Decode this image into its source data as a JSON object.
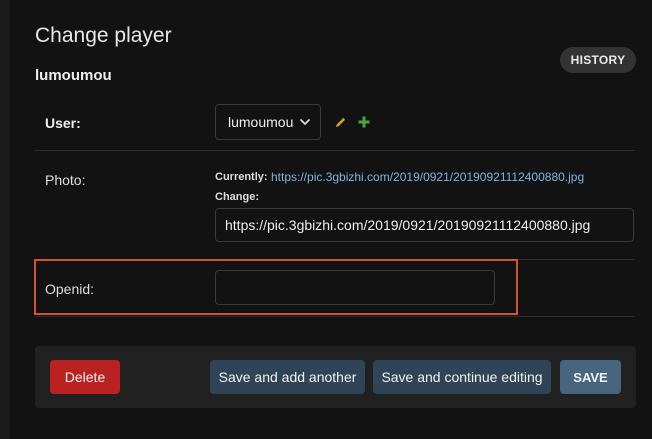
{
  "page": {
    "title": "Change player",
    "object_name": "lumoumou"
  },
  "header": {
    "history_label": "HISTORY"
  },
  "fields": {
    "user": {
      "label": "User:",
      "selected": "lumoumou"
    },
    "photo": {
      "label": "Photo:",
      "currently_label": "Currently:",
      "currently_link": "https://pic.3gbizhi.com/2019/0921/20190921112400880.jpg",
      "change_label": "Change:",
      "value": "https://pic.3gbizhi.com/2019/0921/20190921112400880.jpg"
    },
    "openid": {
      "label": "Openid:",
      "value": ""
    }
  },
  "actions": {
    "delete": "Delete",
    "save_add_another": "Save and add another",
    "save_continue": "Save and continue editing",
    "save": "SAVE"
  },
  "colors": {
    "background": "#121212",
    "delete": "#ba2121",
    "secondary_button": "#2f4557",
    "primary_button": "#47657e",
    "link": "#7fb4e0",
    "highlight": "#d35233",
    "edit_icon": "#c9a227",
    "add_icon": "#44a53c"
  }
}
